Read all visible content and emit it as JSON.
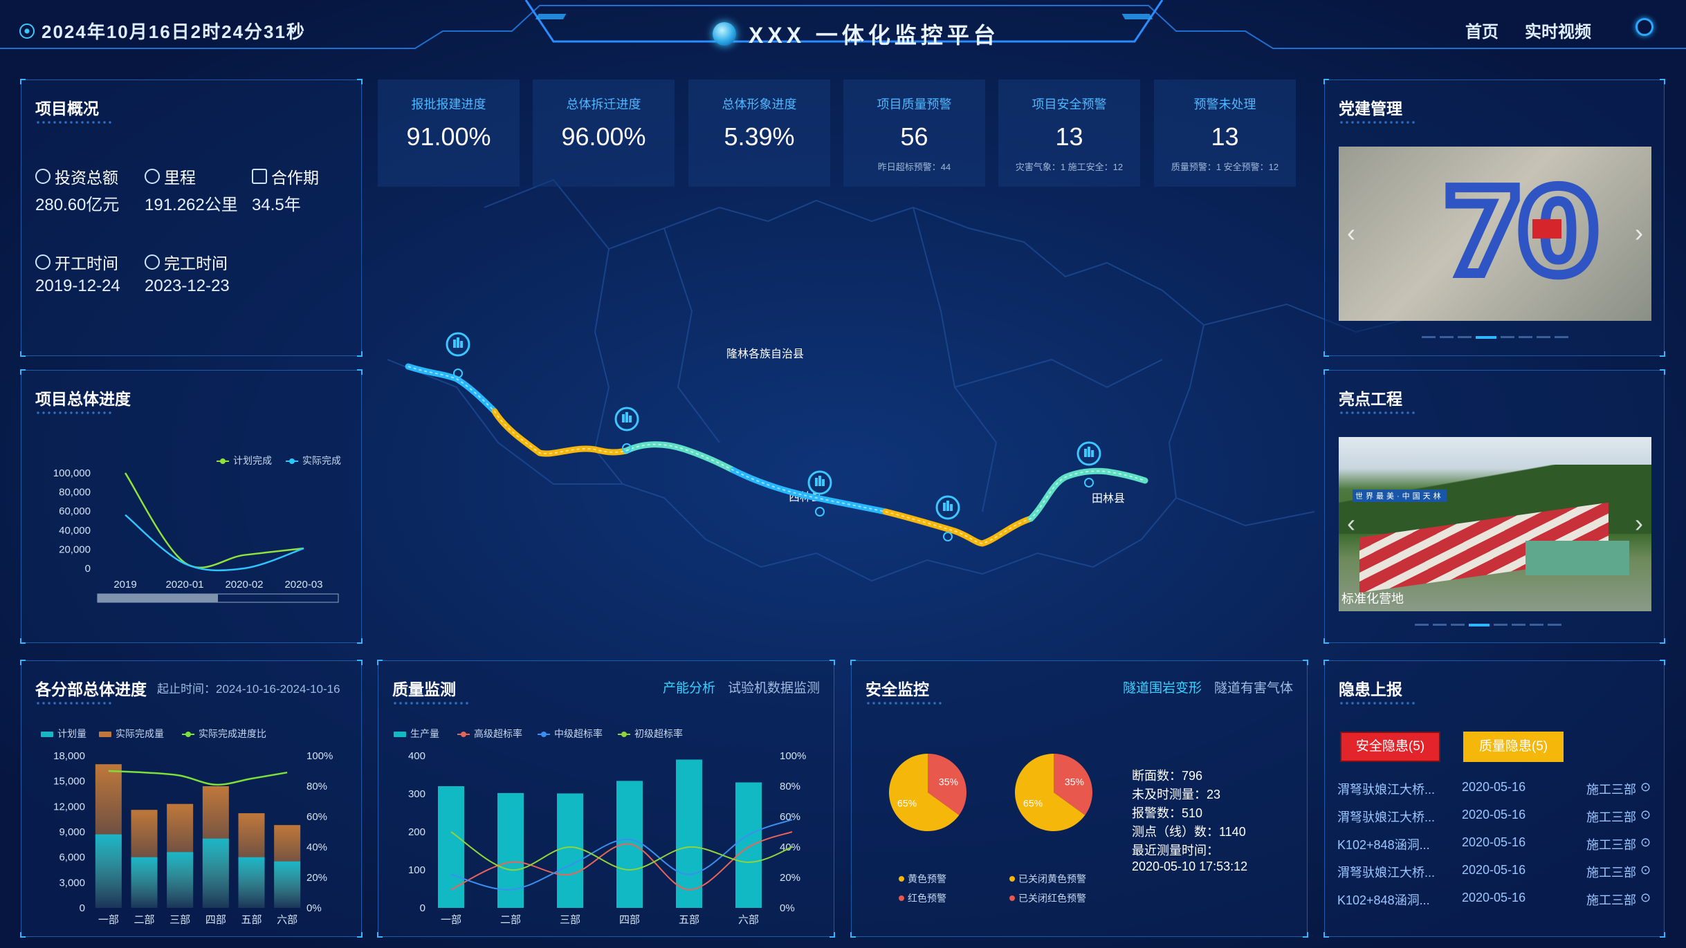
{
  "header": {
    "datetime": "2024年10月16日2时24分31秒",
    "title": "XXX 一体化监控平台",
    "nav": [
      "首页",
      "实时视频"
    ],
    "power_icon": "power-icon"
  },
  "kpis": [
    {
      "label": "报批报建进度",
      "value": "91.00%",
      "sub": ""
    },
    {
      "label": "总体拆迁进度",
      "value": "96.00%",
      "sub": ""
    },
    {
      "label": "总体形象进度",
      "value": "5.39%",
      "sub": ""
    },
    {
      "label": "项目质量预警",
      "value": "56",
      "sub": "昨日超标预警：44"
    },
    {
      "label": "项目安全预警",
      "value": "13",
      "sub": "灾害气象：1 施工安全：12"
    },
    {
      "label": "预警未处理",
      "value": "13",
      "sub": "质量预警：1 安全预警：12"
    }
  ],
  "overview": {
    "title": "项目概况",
    "items": [
      {
        "label": "投资总额",
        "value": "280.60亿元"
      },
      {
        "label": "里程",
        "value": "191.262公里"
      },
      {
        "label": "合作期",
        "value": "34.5年"
      },
      {
        "label": "开工时间",
        "value": "2019-12-24"
      },
      {
        "label": "完工时间",
        "value": "2023-12-23"
      }
    ]
  },
  "map": {
    "labels": [
      "隆林各族自治县",
      "田林县",
      "西林县"
    ]
  },
  "progress": {
    "title": "项目总体进度",
    "chart_data": {
      "type": "line",
      "x": [
        "2019",
        "2020-01",
        "2020-02",
        "2020-03"
      ],
      "series": [
        {
          "name": "计划完成",
          "values": [
            100000,
            6000,
            14000,
            21000
          ],
          "color": "#8fe33a"
        },
        {
          "name": "实际完成",
          "values": [
            56000,
            5000,
            0,
            21000
          ],
          "color": "#2fc6ff"
        }
      ],
      "yticks": [
        "100,000",
        "80,000",
        "60,000",
        "40,000",
        "20,000",
        "0"
      ],
      "ylim": [
        0,
        100000
      ]
    }
  },
  "department": {
    "title": "各分部总体进度",
    "subtitle": "起止时间：2024-10-16-2024-10-16",
    "chart_data": {
      "type": "bar",
      "categories": [
        "一部",
        "二部",
        "三部",
        "四部",
        "五部",
        "六部"
      ],
      "series": [
        {
          "name": "计划量",
          "values": [
            8700,
            6000,
            6600,
            8200,
            6000,
            5500
          ],
          "color": "#19b6c8"
        },
        {
          "name": "实际完成量",
          "values": [
            17000,
            11600,
            12300,
            14400,
            11200,
            9800
          ],
          "color": "#c0783a"
        },
        {
          "name": "实际完成进度比",
          "values": [
            90,
            89,
            87,
            81,
            85,
            89
          ],
          "color": "#7ce03a"
        }
      ],
      "yticks_left": [
        "18,000",
        "15,000",
        "12,000",
        "9,000",
        "6,000",
        "3,000",
        "0"
      ],
      "yticks_right": [
        "100%",
        "80%",
        "60%",
        "40%",
        "20%",
        "0%"
      ],
      "ylim": [
        0,
        18000
      ]
    }
  },
  "quality": {
    "title": "质量监测",
    "tabs": [
      "产能分析",
      "试验机数据监测"
    ],
    "chart_data": {
      "type": "bar",
      "categories": [
        "一部",
        "二部",
        "三部",
        "四部",
        "五部",
        "六部"
      ],
      "series": [
        {
          "name": "生产量",
          "values": [
            320,
            302,
            301,
            334,
            390,
            330
          ],
          "color": "#11b9c4"
        },
        {
          "name": "高级超标率",
          "values": [
            12,
            30,
            22,
            42,
            12,
            40
          ],
          "color": "#e8655a"
        },
        {
          "name": "中级超标率",
          "values": [
            22,
            12,
            28,
            45,
            22,
            48
          ],
          "color": "#3a8fef"
        },
        {
          "name": "初级超标率",
          "values": [
            50,
            25,
            40,
            25,
            40,
            30
          ],
          "color": "#8fd43a"
        }
      ],
      "yticks_left": [
        "400",
        "300",
        "200",
        "100",
        "0"
      ],
      "yticks_right": [
        "100%",
        "80%",
        "60%",
        "40%",
        "20%",
        "0%"
      ],
      "ylim": [
        0,
        400
      ]
    }
  },
  "safety": {
    "title": "安全监控",
    "tabs": [
      "隧道围岩变形",
      "隧道有害气体"
    ],
    "chart_data": {
      "type": "pie",
      "pies": [
        {
          "slices": [
            {
              "label": "35%",
              "value": 35,
              "color": "#e8584c"
            },
            {
              "label": "65%",
              "value": 65,
              "color": "#f5b70a"
            }
          ]
        },
        {
          "slices": [
            {
              "label": "35%",
              "value": 35,
              "color": "#e8584c"
            },
            {
              "label": "65%",
              "value": 65,
              "color": "#f5b70a"
            }
          ]
        }
      ]
    },
    "legend": [
      {
        "name": "黄色预警",
        "color": "#f5b70a"
      },
      {
        "name": "已关闭黄色预警",
        "color": "#f5b70a"
      },
      {
        "name": "红色预警",
        "color": "#e8584c"
      },
      {
        "name": "已关闭红色预警",
        "color": "#e8584c"
      }
    ],
    "stats": [
      "断面数：796",
      "未及时测量：23",
      "报警数：510",
      "测点（线）数：1140",
      "最近测量时间：",
      "2020-05-10 17:53:12"
    ]
  },
  "party": {
    "title": "党建管理",
    "photo_label": "70"
  },
  "highlight": {
    "title": "亮点工程",
    "caption": "标准化营地",
    "sign": "世界最美·中国天林"
  },
  "hazard": {
    "title": "隐患上报",
    "buttons": [
      "安全隐患(5)",
      "质量隐患(5)"
    ],
    "rows": [
      {
        "name": "渭弩驮娘江大桥...",
        "date": "2020-05-16",
        "dept": "施工三部"
      },
      {
        "name": "渭弩驮娘江大桥...",
        "date": "2020-05-16",
        "dept": "施工三部"
      },
      {
        "name": "K102+848涵洞...",
        "date": "2020-05-16",
        "dept": "施工三部"
      },
      {
        "name": "渭弩驮娘江大桥...",
        "date": "2020-05-16",
        "dept": "施工三部"
      },
      {
        "name": "K102+848涵洞...",
        "date": "2020-05-16",
        "dept": "施工三部"
      }
    ]
  }
}
